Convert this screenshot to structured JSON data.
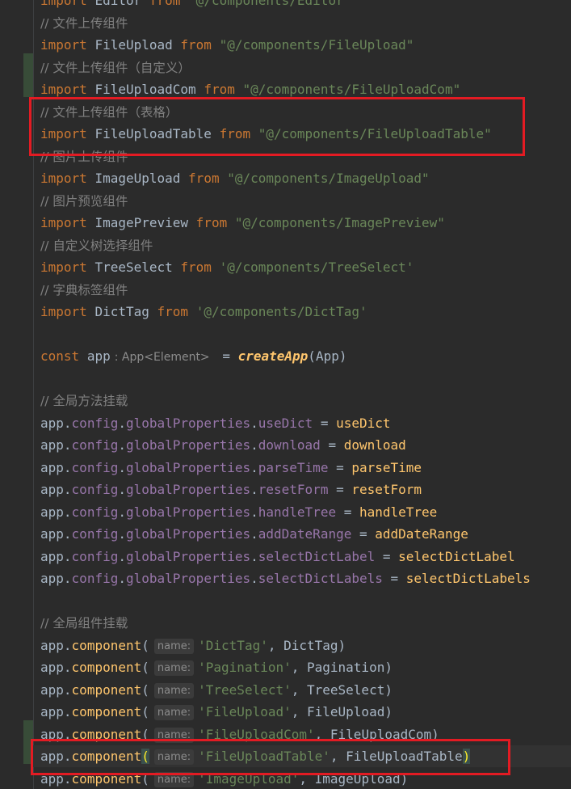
{
  "editor": {
    "lines": [
      {
        "type": "import",
        "name": "Editor",
        "from": "from",
        "path": "\"@/components/Editor\""
      },
      {
        "type": "comment",
        "text": "// 文件上传组件"
      },
      {
        "type": "import",
        "name": "FileUpload",
        "from": "from",
        "path": "\"@/components/FileUpload\""
      },
      {
        "type": "comment",
        "text": "// 文件上传组件（自定义）"
      },
      {
        "type": "import",
        "name": "FileUploadCom",
        "from": "from",
        "path": "\"@/components/FileUploadCom\""
      },
      {
        "type": "comment",
        "text": "// 文件上传组件（表格）"
      },
      {
        "type": "import",
        "name": "FileUploadTable",
        "from": "from",
        "path": "\"@/components/FileUploadTable\""
      },
      {
        "type": "comment",
        "text": "// 图片上传组件"
      },
      {
        "type": "import",
        "name": "ImageUpload",
        "from": "from",
        "path": "\"@/components/ImageUpload\""
      },
      {
        "type": "comment",
        "text": "// 图片预览组件"
      },
      {
        "type": "import",
        "name": "ImagePreview",
        "from": "from",
        "path": "\"@/components/ImagePreview\""
      },
      {
        "type": "comment",
        "text": "// 自定义树选择组件"
      },
      {
        "type": "import",
        "name": "TreeSelect",
        "from": "from",
        "path": "'@/components/TreeSelect'"
      },
      {
        "type": "comment",
        "text": "// 字典标签组件"
      },
      {
        "type": "import",
        "name": "DictTag",
        "from": "from",
        "path": "'@/components/DictTag'"
      },
      {
        "type": "blank"
      },
      {
        "type": "const",
        "keyword": "const",
        "name": "app",
        "typeHint": ": App<Element>",
        "op": "=",
        "fn": "createApp",
        "arg": "App"
      },
      {
        "type": "blank"
      },
      {
        "type": "comment",
        "text": "// 全局方法挂载"
      },
      {
        "type": "assign",
        "obj": "app",
        "chain": [
          "config",
          "globalProperties",
          "useDict"
        ],
        "value": "useDict"
      },
      {
        "type": "assign",
        "obj": "app",
        "chain": [
          "config",
          "globalProperties",
          "download"
        ],
        "value": "download"
      },
      {
        "type": "assign",
        "obj": "app",
        "chain": [
          "config",
          "globalProperties",
          "parseTime"
        ],
        "value": "parseTime"
      },
      {
        "type": "assign",
        "obj": "app",
        "chain": [
          "config",
          "globalProperties",
          "resetForm"
        ],
        "value": "resetForm"
      },
      {
        "type": "assign",
        "obj": "app",
        "chain": [
          "config",
          "globalProperties",
          "handleTree"
        ],
        "value": "handleTree"
      },
      {
        "type": "assign",
        "obj": "app",
        "chain": [
          "config",
          "globalProperties",
          "addDateRange"
        ],
        "value": "addDateRange"
      },
      {
        "type": "assign",
        "obj": "app",
        "chain": [
          "config",
          "globalProperties",
          "selectDictLabel"
        ],
        "value": "selectDictLabel"
      },
      {
        "type": "assign",
        "obj": "app",
        "chain": [
          "config",
          "globalProperties",
          "selectDictLabels"
        ],
        "value": "selectDictLabels"
      },
      {
        "type": "blank"
      },
      {
        "type": "comment",
        "text": "// 全局组件挂载"
      },
      {
        "type": "call",
        "obj": "app",
        "method": "component",
        "hint": "name:",
        "str": "'DictTag'",
        "arg": "DictTag"
      },
      {
        "type": "call",
        "obj": "app",
        "method": "component",
        "hint": "name:",
        "str": "'Pagination'",
        "arg": "Pagination"
      },
      {
        "type": "call",
        "obj": "app",
        "method": "component",
        "hint": "name:",
        "str": "'TreeSelect'",
        "arg": "TreeSelect"
      },
      {
        "type": "call",
        "obj": "app",
        "method": "component",
        "hint": "name:",
        "str": "'FileUpload'",
        "arg": "FileUpload"
      },
      {
        "type": "call",
        "obj": "app",
        "method": "component",
        "hint": "name:",
        "str": "'FileUploadCom'",
        "arg": "FileUploadCom"
      },
      {
        "type": "call",
        "obj": "app",
        "method": "component",
        "hint": "name:",
        "str": "'FileUploadTable'",
        "arg": "FileUploadTable",
        "current": true
      },
      {
        "type": "call",
        "obj": "app",
        "method": "component",
        "hint": "name:",
        "str": "'ImageUpload'",
        "arg": "ImageUpload"
      }
    ]
  },
  "colors": {
    "background": "#2b2b2b",
    "keyword": "#cc7832",
    "string": "#6a8759",
    "comment": "#808080",
    "property": "#9876aa",
    "function": "#ffc66d",
    "identifier": "#a9b7c6",
    "highlight_box": "#e31b23"
  }
}
